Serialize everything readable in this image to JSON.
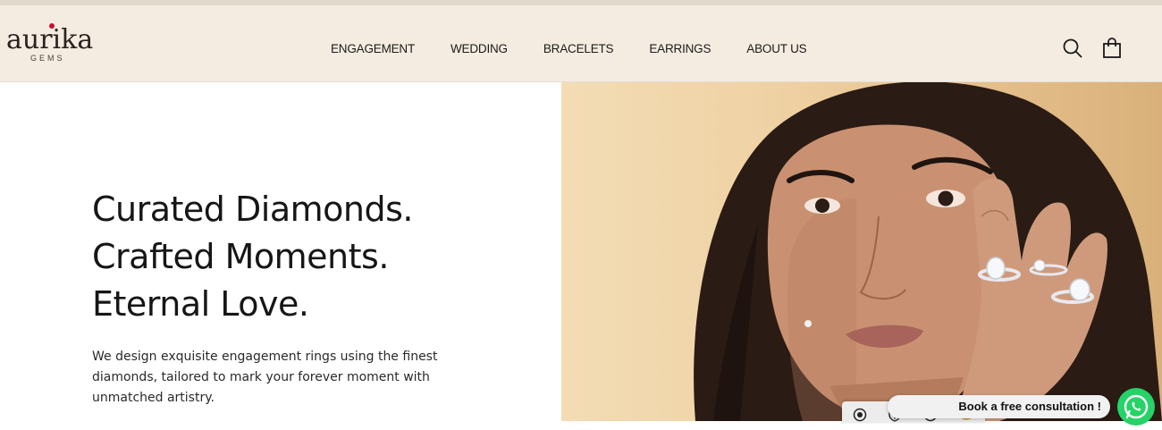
{
  "brand": {
    "name": "aurika",
    "sub": "GEMS",
    "accent": "#c8102e"
  },
  "nav": {
    "items": [
      {
        "label": "ENGAGEMENT"
      },
      {
        "label": "WEDDING"
      },
      {
        "label": "BRACELETS"
      },
      {
        "label": "EARRINGS"
      },
      {
        "label": "ABOUT US"
      }
    ]
  },
  "header_icons": {
    "search": "search-icon",
    "bag": "shopping-bag-icon"
  },
  "hero": {
    "line1": "Curated Diamonds.",
    "line2": "Crafted Moments.",
    "line3": "Eternal Love.",
    "description": "We design exquisite engagement rings using the finest diamonds, tailored to mark your forever moment with unmatched artistry."
  },
  "widgets": {
    "consult_label": "Book a free consultation !",
    "whatsapp_icon": "whatsapp-icon",
    "toolbar_icons": [
      "record-icon",
      "shield-icon",
      "block-icon",
      "coins-icon"
    ]
  },
  "colors": {
    "header_bg": "#f4ece1",
    "text": "#161616"
  }
}
